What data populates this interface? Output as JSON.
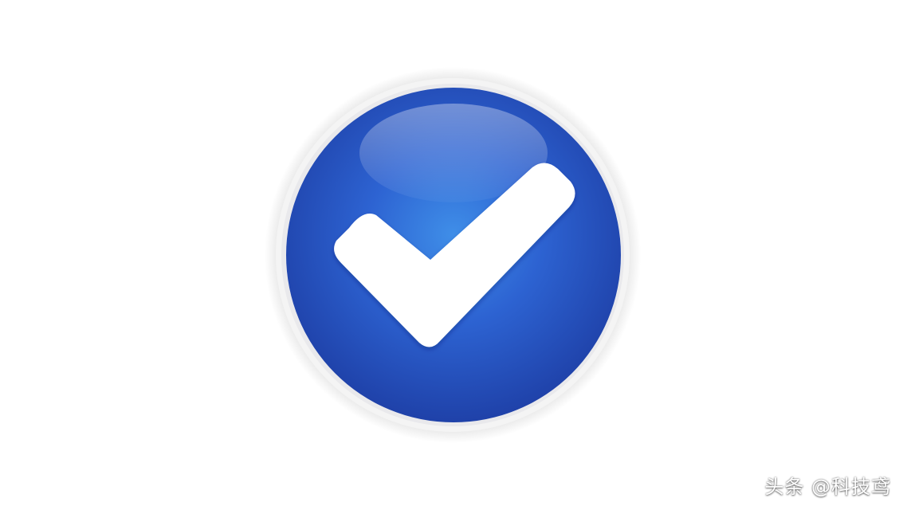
{
  "badge": {
    "icon": "checkmark-icon",
    "fill_color": "#2a55c4",
    "highlight_color": "#3f8ee8",
    "check_color": "#ffffff",
    "ring_color": "#f1f1f1"
  },
  "watermark": {
    "text": "头条 @科技鸢"
  }
}
